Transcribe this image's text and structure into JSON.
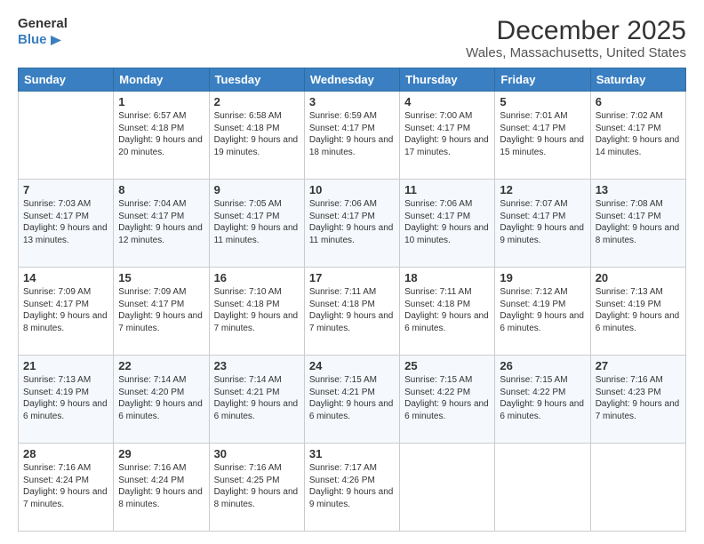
{
  "logo": {
    "line1": "General",
    "line2": "Blue"
  },
  "title": "December 2025",
  "subtitle": "Wales, Massachusetts, United States",
  "days_of_week": [
    "Sunday",
    "Monday",
    "Tuesday",
    "Wednesday",
    "Thursday",
    "Friday",
    "Saturday"
  ],
  "weeks": [
    [
      {
        "day": "",
        "sunrise": "",
        "sunset": "",
        "daylight": ""
      },
      {
        "day": "1",
        "sunrise": "Sunrise: 6:57 AM",
        "sunset": "Sunset: 4:18 PM",
        "daylight": "Daylight: 9 hours and 20 minutes."
      },
      {
        "day": "2",
        "sunrise": "Sunrise: 6:58 AM",
        "sunset": "Sunset: 4:18 PM",
        "daylight": "Daylight: 9 hours and 19 minutes."
      },
      {
        "day": "3",
        "sunrise": "Sunrise: 6:59 AM",
        "sunset": "Sunset: 4:17 PM",
        "daylight": "Daylight: 9 hours and 18 minutes."
      },
      {
        "day": "4",
        "sunrise": "Sunrise: 7:00 AM",
        "sunset": "Sunset: 4:17 PM",
        "daylight": "Daylight: 9 hours and 17 minutes."
      },
      {
        "day": "5",
        "sunrise": "Sunrise: 7:01 AM",
        "sunset": "Sunset: 4:17 PM",
        "daylight": "Daylight: 9 hours and 15 minutes."
      },
      {
        "day": "6",
        "sunrise": "Sunrise: 7:02 AM",
        "sunset": "Sunset: 4:17 PM",
        "daylight": "Daylight: 9 hours and 14 minutes."
      }
    ],
    [
      {
        "day": "7",
        "sunrise": "Sunrise: 7:03 AM",
        "sunset": "Sunset: 4:17 PM",
        "daylight": "Daylight: 9 hours and 13 minutes."
      },
      {
        "day": "8",
        "sunrise": "Sunrise: 7:04 AM",
        "sunset": "Sunset: 4:17 PM",
        "daylight": "Daylight: 9 hours and 12 minutes."
      },
      {
        "day": "9",
        "sunrise": "Sunrise: 7:05 AM",
        "sunset": "Sunset: 4:17 PM",
        "daylight": "Daylight: 9 hours and 11 minutes."
      },
      {
        "day": "10",
        "sunrise": "Sunrise: 7:06 AM",
        "sunset": "Sunset: 4:17 PM",
        "daylight": "Daylight: 9 hours and 11 minutes."
      },
      {
        "day": "11",
        "sunrise": "Sunrise: 7:06 AM",
        "sunset": "Sunset: 4:17 PM",
        "daylight": "Daylight: 9 hours and 10 minutes."
      },
      {
        "day": "12",
        "sunrise": "Sunrise: 7:07 AM",
        "sunset": "Sunset: 4:17 PM",
        "daylight": "Daylight: 9 hours and 9 minutes."
      },
      {
        "day": "13",
        "sunrise": "Sunrise: 7:08 AM",
        "sunset": "Sunset: 4:17 PM",
        "daylight": "Daylight: 9 hours and 8 minutes."
      }
    ],
    [
      {
        "day": "14",
        "sunrise": "Sunrise: 7:09 AM",
        "sunset": "Sunset: 4:17 PM",
        "daylight": "Daylight: 9 hours and 8 minutes."
      },
      {
        "day": "15",
        "sunrise": "Sunrise: 7:09 AM",
        "sunset": "Sunset: 4:17 PM",
        "daylight": "Daylight: 9 hours and 7 minutes."
      },
      {
        "day": "16",
        "sunrise": "Sunrise: 7:10 AM",
        "sunset": "Sunset: 4:18 PM",
        "daylight": "Daylight: 9 hours and 7 minutes."
      },
      {
        "day": "17",
        "sunrise": "Sunrise: 7:11 AM",
        "sunset": "Sunset: 4:18 PM",
        "daylight": "Daylight: 9 hours and 7 minutes."
      },
      {
        "day": "18",
        "sunrise": "Sunrise: 7:11 AM",
        "sunset": "Sunset: 4:18 PM",
        "daylight": "Daylight: 9 hours and 6 minutes."
      },
      {
        "day": "19",
        "sunrise": "Sunrise: 7:12 AM",
        "sunset": "Sunset: 4:19 PM",
        "daylight": "Daylight: 9 hours and 6 minutes."
      },
      {
        "day": "20",
        "sunrise": "Sunrise: 7:13 AM",
        "sunset": "Sunset: 4:19 PM",
        "daylight": "Daylight: 9 hours and 6 minutes."
      }
    ],
    [
      {
        "day": "21",
        "sunrise": "Sunrise: 7:13 AM",
        "sunset": "Sunset: 4:19 PM",
        "daylight": "Daylight: 9 hours and 6 minutes."
      },
      {
        "day": "22",
        "sunrise": "Sunrise: 7:14 AM",
        "sunset": "Sunset: 4:20 PM",
        "daylight": "Daylight: 9 hours and 6 minutes."
      },
      {
        "day": "23",
        "sunrise": "Sunrise: 7:14 AM",
        "sunset": "Sunset: 4:21 PM",
        "daylight": "Daylight: 9 hours and 6 minutes."
      },
      {
        "day": "24",
        "sunrise": "Sunrise: 7:15 AM",
        "sunset": "Sunset: 4:21 PM",
        "daylight": "Daylight: 9 hours and 6 minutes."
      },
      {
        "day": "25",
        "sunrise": "Sunrise: 7:15 AM",
        "sunset": "Sunset: 4:22 PM",
        "daylight": "Daylight: 9 hours and 6 minutes."
      },
      {
        "day": "26",
        "sunrise": "Sunrise: 7:15 AM",
        "sunset": "Sunset: 4:22 PM",
        "daylight": "Daylight: 9 hours and 6 minutes."
      },
      {
        "day": "27",
        "sunrise": "Sunrise: 7:16 AM",
        "sunset": "Sunset: 4:23 PM",
        "daylight": "Daylight: 9 hours and 7 minutes."
      }
    ],
    [
      {
        "day": "28",
        "sunrise": "Sunrise: 7:16 AM",
        "sunset": "Sunset: 4:24 PM",
        "daylight": "Daylight: 9 hours and 7 minutes."
      },
      {
        "day": "29",
        "sunrise": "Sunrise: 7:16 AM",
        "sunset": "Sunset: 4:24 PM",
        "daylight": "Daylight: 9 hours and 8 minutes."
      },
      {
        "day": "30",
        "sunrise": "Sunrise: 7:16 AM",
        "sunset": "Sunset: 4:25 PM",
        "daylight": "Daylight: 9 hours and 8 minutes."
      },
      {
        "day": "31",
        "sunrise": "Sunrise: 7:17 AM",
        "sunset": "Sunset: 4:26 PM",
        "daylight": "Daylight: 9 hours and 9 minutes."
      },
      {
        "day": "",
        "sunrise": "",
        "sunset": "",
        "daylight": ""
      },
      {
        "day": "",
        "sunrise": "",
        "sunset": "",
        "daylight": ""
      },
      {
        "day": "",
        "sunrise": "",
        "sunset": "",
        "daylight": ""
      }
    ]
  ]
}
